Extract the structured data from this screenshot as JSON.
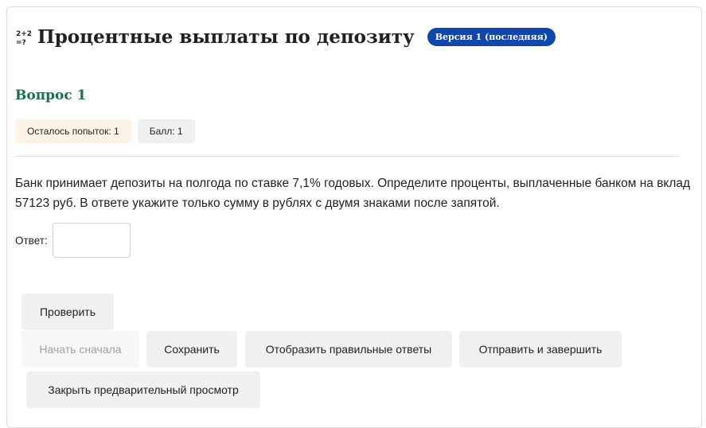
{
  "header": {
    "title": "Процентные выплаты по депозиту",
    "icon": "calculator-icon",
    "version_badge": "Версия 1 (последняя)"
  },
  "question": {
    "title": "Вопрос 1",
    "attempts": "Осталось попыток: 1",
    "score": "Балл: 1",
    "text": "Банк принимает депозиты на полгода по ставке 7,1% годовых. Определите проценты, выплаченные банком на вклад 57123 руб. В ответе укажите только сумму в рублях с двумя знаками после запятой.",
    "answer_label": "Ответ:",
    "answer_value": ""
  },
  "buttons": {
    "check": "Проверить",
    "restart": "Начать сначала",
    "save": "Сохранить",
    "show_answers": "Отобразить правильные ответы",
    "submit": "Отправить и завершить",
    "close_preview": "Закрыть предварительный просмотр"
  },
  "colors": {
    "badge": "#0f47ad",
    "question_title": "#1a7048",
    "attempts_bg": "#fcf3e4",
    "button_bg": "#f0f0f0"
  }
}
